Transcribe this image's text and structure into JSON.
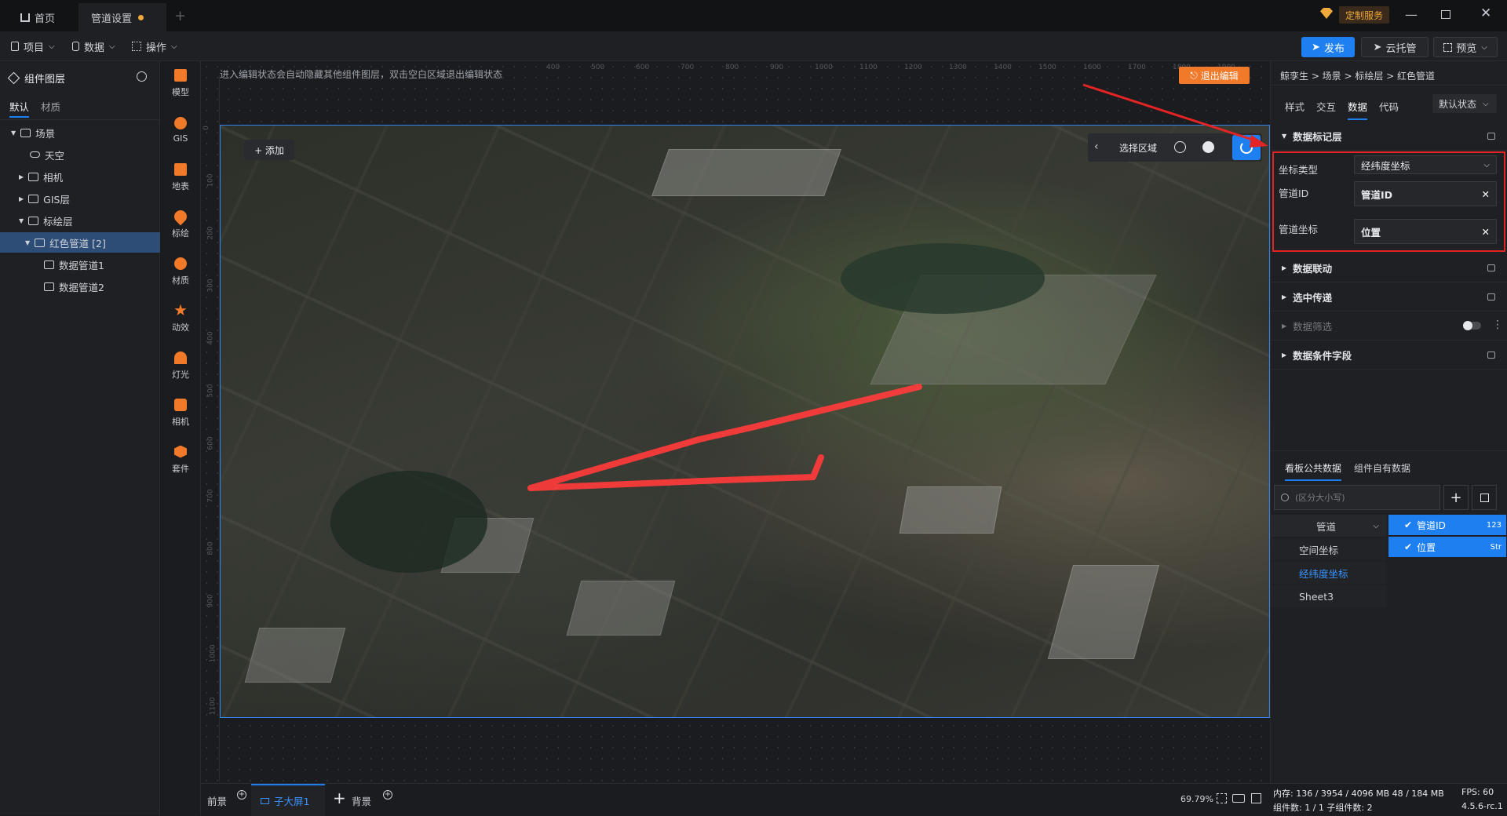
{
  "tabs": [
    {
      "label": "首页"
    },
    {
      "label": "管道设置"
    }
  ],
  "topbar": {
    "custom_service": "定制服务"
  },
  "menu": {
    "project": "项目",
    "data": "数据",
    "operate": "操作"
  },
  "actions": {
    "publish": "发布",
    "cloud": "云托管",
    "preview": "预览"
  },
  "layers": {
    "title": "组件图层",
    "tabs": [
      "默认",
      "材质"
    ],
    "tree": [
      {
        "label": "场景"
      },
      {
        "label": "天空"
      },
      {
        "label": "相机"
      },
      {
        "label": "GIS层"
      },
      {
        "label": "标绘层"
      },
      {
        "label": "红色管道 [2]"
      },
      {
        "label": "数据管道1"
      },
      {
        "label": "数据管道2"
      }
    ]
  },
  "rail": [
    "模型",
    "GIS",
    "地表",
    "标绘",
    "材质",
    "动效",
    "灯光",
    "相机",
    "套件"
  ],
  "canvas": {
    "hint": "进入编辑状态会自动隐藏其他组件图层，双击空白区域退出编辑状态",
    "exit_edit": "退出编辑",
    "add": "+ 添加",
    "select_area": "选择区域",
    "ruler_top": [
      "400",
      "500",
      "600",
      "700",
      "800",
      "900",
      "1000",
      "1100",
      "1200",
      "1300",
      "1400",
      "1500",
      "1600",
      "1700",
      "1800",
      "1900"
    ],
    "ruler_left": [
      "0",
      "100",
      "200",
      "300",
      "400",
      "500",
      "600",
      "700",
      "800",
      "900",
      "1000",
      "1100"
    ]
  },
  "props": {
    "breadcrumb": "鲸孪生 > 场景 > 标绘层 > 红色管道",
    "tabs": [
      "样式",
      "交互",
      "数据",
      "代码"
    ],
    "state": "默认状态",
    "section_marker": "数据标记层",
    "coord_type_label": "坐标类型",
    "coord_type_value": "经纬度坐标",
    "pipe_id_label": "管道ID",
    "pipe_id_value": "管道ID",
    "pipe_coord_label": "管道坐标",
    "pipe_coord_value": "位置",
    "sections": [
      "数据联动",
      "选中传递",
      "数据筛选",
      "数据条件字段"
    ],
    "data_tabs": [
      "看板公共数据",
      "组件自有数据"
    ],
    "search_placeholder": "(区分大小写)",
    "sources": [
      "管道",
      "空间坐标",
      "经纬度坐标",
      "Sheet3"
    ],
    "fields": [
      {
        "name": "管道ID",
        "type": "123"
      },
      {
        "name": "位置",
        "type": "Str"
      }
    ]
  },
  "bottom": {
    "front": "前景",
    "screen": "子大屏1",
    "bg": "背景",
    "zoom": "69.79%"
  },
  "status": {
    "memory": "内存: 136 / 3954 / 4096 MB  48 / 184 MB",
    "fps": "FPS: 60",
    "components": "组件数: 1 / 1   子组件数: 2",
    "version": "4.5.6-rc.1"
  },
  "colors": {
    "accent": "#1e7ff0",
    "selection": "#2d4c76",
    "highlight": "#e22424",
    "pipe": "#ff3b3b"
  }
}
